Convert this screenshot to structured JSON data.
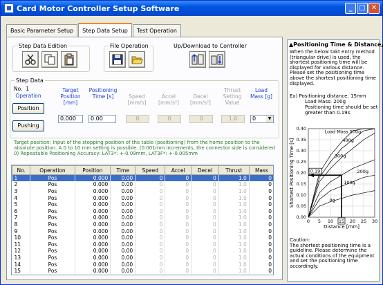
{
  "window": {
    "title": "Card Motor Controller Setup Software",
    "colors": {
      "titlebar": "#0054e3",
      "accent": "#e68b2c",
      "selection": "#3a6ec8"
    }
  },
  "tabs": [
    "Basic Parameter Setup",
    "Step Data Setup",
    "Test Operation"
  ],
  "groups": {
    "step_edit": "Step Data Edition",
    "file_op": "File Operation",
    "updown": "Up/Download to Controller",
    "step_data": "Step Data"
  },
  "step": {
    "no_label": "No.",
    "no_value": "1",
    "operation_label": "Operation",
    "position_btn": "Position",
    "pushing_btn": "Pushing",
    "cols": {
      "target": "Target Position [mm]",
      "time": "Positioning Time [s]",
      "speed": "Speed [mm/s]",
      "accel": "Accel [mm/s²]",
      "decel": "Decel [mm/s²]",
      "thrust": "Thrust Setting Value",
      "mass": "Load Mass [g]"
    },
    "values": {
      "target": "0.000",
      "time": "0.00",
      "speed": "0",
      "accel": "0",
      "decel": "0",
      "thrust": "1.0",
      "mass": "0"
    }
  },
  "note": "Target position: Input of the stopping position of the table (positioning) from the home position to the absolute position. A 0 to 10 mm setting is possible. (0.001mm increments, the connector side is considered 0) Repeatable Positioning Accuracy: LAT3*: +-0.09mm, LAT3F*: +-0.005mm",
  "table": {
    "headers": [
      "No.",
      "Operation",
      "Position",
      "Time",
      "Speed",
      "Accel",
      "Decel",
      "Thrust",
      "Mass"
    ],
    "rows": [
      [
        "1",
        "Pos",
        "0.000",
        "0.00",
        "0",
        "0",
        "0",
        "1.0",
        "0"
      ],
      [
        "2",
        "Pos",
        "0.000",
        "0.00",
        "0",
        "0",
        "0",
        "1.0",
        "0"
      ],
      [
        "3",
        "Pos",
        "0.000",
        "0.00",
        "0",
        "0",
        "0",
        "1.0",
        "0"
      ],
      [
        "4",
        "Pos",
        "0.000",
        "0.00",
        "0",
        "0",
        "0",
        "1.0",
        "0"
      ],
      [
        "5",
        "Pos",
        "0.000",
        "0.00",
        "0",
        "0",
        "0",
        "1.0",
        "0"
      ],
      [
        "6",
        "Pos",
        "0.000",
        "0.00",
        "0",
        "0",
        "0",
        "1.0",
        "0"
      ],
      [
        "7",
        "Pos",
        "0.000",
        "0.00",
        "0",
        "0",
        "0",
        "1.0",
        "0"
      ],
      [
        "8",
        "Pos",
        "0.000",
        "0.00",
        "0",
        "0",
        "0",
        "1.0",
        "0"
      ],
      [
        "9",
        "Pos",
        "0.000",
        "0.00",
        "0",
        "0",
        "0",
        "1.0",
        "0"
      ],
      [
        "10",
        "Pos",
        "0.000",
        "0.00",
        "0",
        "0",
        "0",
        "1.0",
        "0"
      ],
      [
        "11",
        "Pos",
        "0.000",
        "0.00",
        "0",
        "0",
        "0",
        "1.0",
        "0"
      ],
      [
        "12",
        "Pos",
        "0.000",
        "0.00",
        "0",
        "0",
        "0",
        "1.0",
        "0"
      ],
      [
        "13",
        "Pos",
        "0.000",
        "0.00",
        "0",
        "0",
        "0",
        "1.0",
        "0"
      ],
      [
        "14",
        "Pos",
        "0.000",
        "0.00",
        "0",
        "0",
        "0",
        "1.0",
        "0"
      ],
      [
        "15",
        "Pos",
        "0.000",
        "0.00",
        "0",
        "0",
        "0",
        "1.0",
        "0"
      ]
    ]
  },
  "right": {
    "title": "▲Positioning Time & Distance▲",
    "intro": "When the below takt entry method (triangular drive) is used, the shortest positioning time will be displayed for various distance. Please set the positioning time above the shortest positioning time displayed.",
    "ex1": "Ex) Positioning distance: 15mm",
    "ex2": "Load Mass: 200g",
    "ex3": "Positioning time should be set greater than 0.19s",
    "caution": "Caution:\nThe shortest positioning time is a guideline. Please determine the actual conditions of the equipment and set the positioning time accordingly."
  },
  "chart_data": {
    "type": "line",
    "xlabel": "Distance [mm]",
    "ylabel": "Shortest Positioning Time [s]",
    "x": [
      0,
      5,
      10,
      15,
      20,
      25,
      30
    ],
    "xticks": [
      "0",
      "5",
      "10",
      "15",
      "20",
      "25",
      "30"
    ],
    "yticks": [
      "0.00",
      "0.05",
      "0.10",
      "0.15",
      "0.20",
      "0.25",
      "0.30",
      "0.35",
      "0.40"
    ],
    "xlim": [
      0,
      30
    ],
    "ylim": [
      0,
      0.4
    ],
    "highlight_x": "15",
    "highlight_y": "0.19",
    "series": [
      {
        "name": "Load Mass 500g",
        "values": [
          0,
          0.2,
          0.28,
          0.34,
          0.39,
          0.43,
          0.47
        ]
      },
      {
        "name": "400g",
        "values": [
          0,
          0.18,
          0.25,
          0.31,
          0.35,
          0.39,
          0.43
        ]
      },
      {
        "name": "300g",
        "values": [
          0,
          0.16,
          0.22,
          0.27,
          0.31,
          0.35,
          0.38
        ]
      },
      {
        "name": "200g",
        "values": [
          0,
          0.11,
          0.16,
          0.19,
          0.22,
          0.24,
          0.26
        ]
      },
      {
        "name": "100g",
        "values": [
          0,
          0.08,
          0.12,
          0.14,
          0.16,
          0.18,
          0.19
        ]
      },
      {
        "name": "0g",
        "values": [
          0,
          0.05,
          0.07,
          0.085,
          0.1,
          0.11,
          0.12
        ]
      }
    ]
  }
}
